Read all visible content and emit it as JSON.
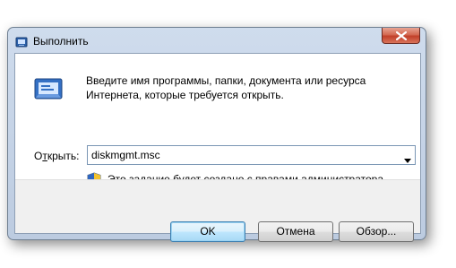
{
  "window": {
    "title": "Выполнить"
  },
  "dialog": {
    "description": "Введите имя программы, папки, документа или ресурса Интернета, которые требуется открыть.",
    "open_label_prefix": "О",
    "open_label_underlined": "т",
    "open_label_suffix": "крыть:",
    "command_value": "diskmgmt.msc",
    "admin_note": "Это задание будет создано с правами администратора"
  },
  "buttons": {
    "ok": "OK",
    "cancel": "Отмена",
    "browse": "Обзор..."
  },
  "colors": {
    "title_bar": "#c6d5e8",
    "close_button": "#c94a33",
    "default_button_border": "#3c7fb1"
  },
  "icons": [
    "run-icon",
    "close-icon",
    "dropdown-arrow-icon",
    "uac-shield-icon"
  ]
}
